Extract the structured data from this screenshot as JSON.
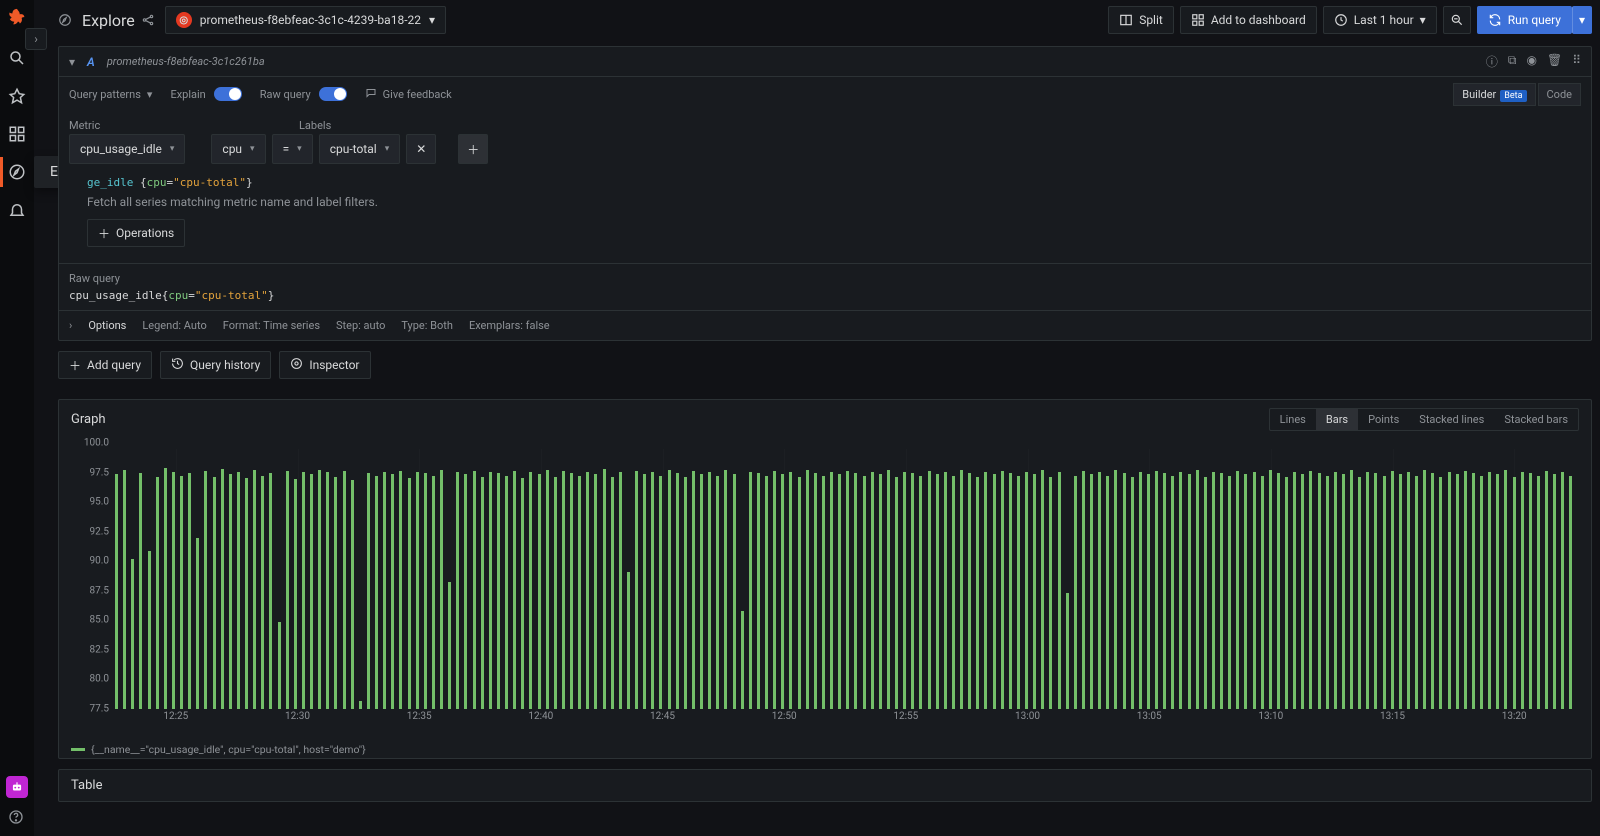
{
  "page_title": "Explore",
  "datasource": {
    "name": "prometheus-f8ebfeac-3c1c-4239-ba18-22",
    "short": "prometheus-f8ebfeac-3c1c261ba"
  },
  "toolbar": {
    "split": "Split",
    "add_to_dashboard": "Add to dashboard",
    "time_range": "Last 1 hour",
    "run_query": "Run query"
  },
  "sidebar_tooltip": "Explore",
  "query_editor": {
    "letter": "A",
    "patterns_label": "Query patterns",
    "explain_label": "Explain",
    "raw_query_label": "Raw query",
    "feedback_label": "Give feedback",
    "builder_label": "Builder",
    "builder_badge": "Beta",
    "code_label": "Code",
    "metric_heading": "Metric",
    "labels_heading": "Labels",
    "metric_value": "cpu_usage_idle",
    "label_key": "cpu",
    "label_op": "=",
    "label_value": "cpu-total",
    "explain_code_metric": "ge_idle",
    "explain_code_key": "cpu",
    "explain_code_val": "cpu-total",
    "explain_text": "Fetch all series matching metric name and label filters.",
    "operations_btn": "Operations",
    "raw_heading": "Raw query",
    "raw_code_metric": "cpu_usage_idle",
    "raw_code_key": "cpu",
    "raw_code_val": "cpu-total",
    "options_label": "Options",
    "opt_legend": "Legend: Auto",
    "opt_format": "Format: Time series",
    "opt_step": "Step: auto",
    "opt_type": "Type: Both",
    "opt_exemplars": "Exemplars: false",
    "add_query_btn": "Add query",
    "history_btn": "Query history",
    "inspector_btn": "Inspector"
  },
  "graph": {
    "title": "Graph",
    "viz_options": [
      "Lines",
      "Bars",
      "Points",
      "Stacked lines",
      "Stacked bars"
    ],
    "viz_active": "Bars",
    "y_ticks": [
      "100.0",
      "97.5",
      "95.0",
      "92.5",
      "90.0",
      "87.5",
      "85.0",
      "82.5",
      "80.0",
      "77.5"
    ],
    "x_ticks": [
      "12:25",
      "12:30",
      "12:35",
      "12:40",
      "12:45",
      "12:50",
      "12:55",
      "13:00",
      "13:05",
      "13:10",
      "13:15",
      "13:20"
    ],
    "legend": "{__name__=\"cpu_usage_idle\", cpu=\"cpu-total\", host=\"demo\"}"
  },
  "table": {
    "title": "Table"
  },
  "chart_data": {
    "type": "bar",
    "title": "",
    "xlabel": "",
    "ylabel": "",
    "ylim": [
      77.5,
      100.0
    ],
    "x_range": [
      "12:22",
      "13:22"
    ],
    "note": "Dense per-sample bars over one hour; each value is approximate cpu_usage_idle percent read from chart.",
    "series": [
      {
        "name": "{__name__=\"cpu_usage_idle\", cpu=\"cpu-total\", host=\"demo\"}",
        "values": [
          97.8,
          98.2,
          90.5,
          97.9,
          91.2,
          97.6,
          98.4,
          98.0,
          97.7,
          97.9,
          92.3,
          98.1,
          97.6,
          98.3,
          97.8,
          98.0,
          97.5,
          98.2,
          97.7,
          97.9,
          85.0,
          98.1,
          97.4,
          98.0,
          97.8,
          98.2,
          98.0,
          97.6,
          98.1,
          97.3,
          78.2,
          97.9,
          97.7,
          98.0,
          97.8,
          98.1,
          97.5,
          98.0,
          97.9,
          97.7,
          98.2,
          88.5,
          98.0,
          97.8,
          98.1,
          97.6,
          98.0,
          97.9,
          97.7,
          98.1,
          97.5,
          98.0,
          97.8,
          98.2,
          97.6,
          98.1,
          97.9,
          97.7,
          98.0,
          97.8,
          98.3,
          97.6,
          98.0,
          89.4,
          98.1,
          97.8,
          98.0,
          97.7,
          98.2,
          97.9,
          97.6,
          98.1,
          97.8,
          98.0,
          97.7,
          98.2,
          97.8,
          86.0,
          98.0,
          97.9,
          97.7,
          98.1,
          97.8,
          98.0,
          97.6,
          98.2,
          97.9,
          97.7,
          98.0,
          97.8,
          98.1,
          97.9,
          97.7,
          98.0,
          97.8,
          98.2,
          97.6,
          98.0,
          97.9,
          97.7,
          98.1,
          97.8,
          98.0,
          97.7,
          98.2,
          97.9,
          97.6,
          98.0,
          97.8,
          98.1,
          97.9,
          97.7,
          98.0,
          97.8,
          98.2,
          97.6,
          98.0,
          87.5,
          97.7,
          98.1,
          97.8,
          98.0,
          97.7,
          98.2,
          97.9,
          97.6,
          98.0,
          97.8,
          98.1,
          97.9,
          97.7,
          98.0,
          97.8,
          98.2,
          97.6,
          98.0,
          97.9,
          97.7,
          98.1,
          97.8,
          98.0,
          97.7,
          98.2,
          97.9,
          97.6,
          98.0,
          97.8,
          98.1,
          97.9,
          97.7,
          98.0,
          97.8,
          98.2,
          97.6,
          98.0,
          97.9,
          97.7,
          98.1,
          97.8,
          98.0,
          97.7,
          98.2,
          97.9,
          97.6,
          98.0,
          97.8,
          98.1,
          97.9,
          97.7,
          98.0,
          97.8,
          98.2,
          97.6,
          98.0,
          97.9,
          97.7,
          98.1,
          97.8,
          98.0,
          97.7
        ]
      }
    ]
  }
}
